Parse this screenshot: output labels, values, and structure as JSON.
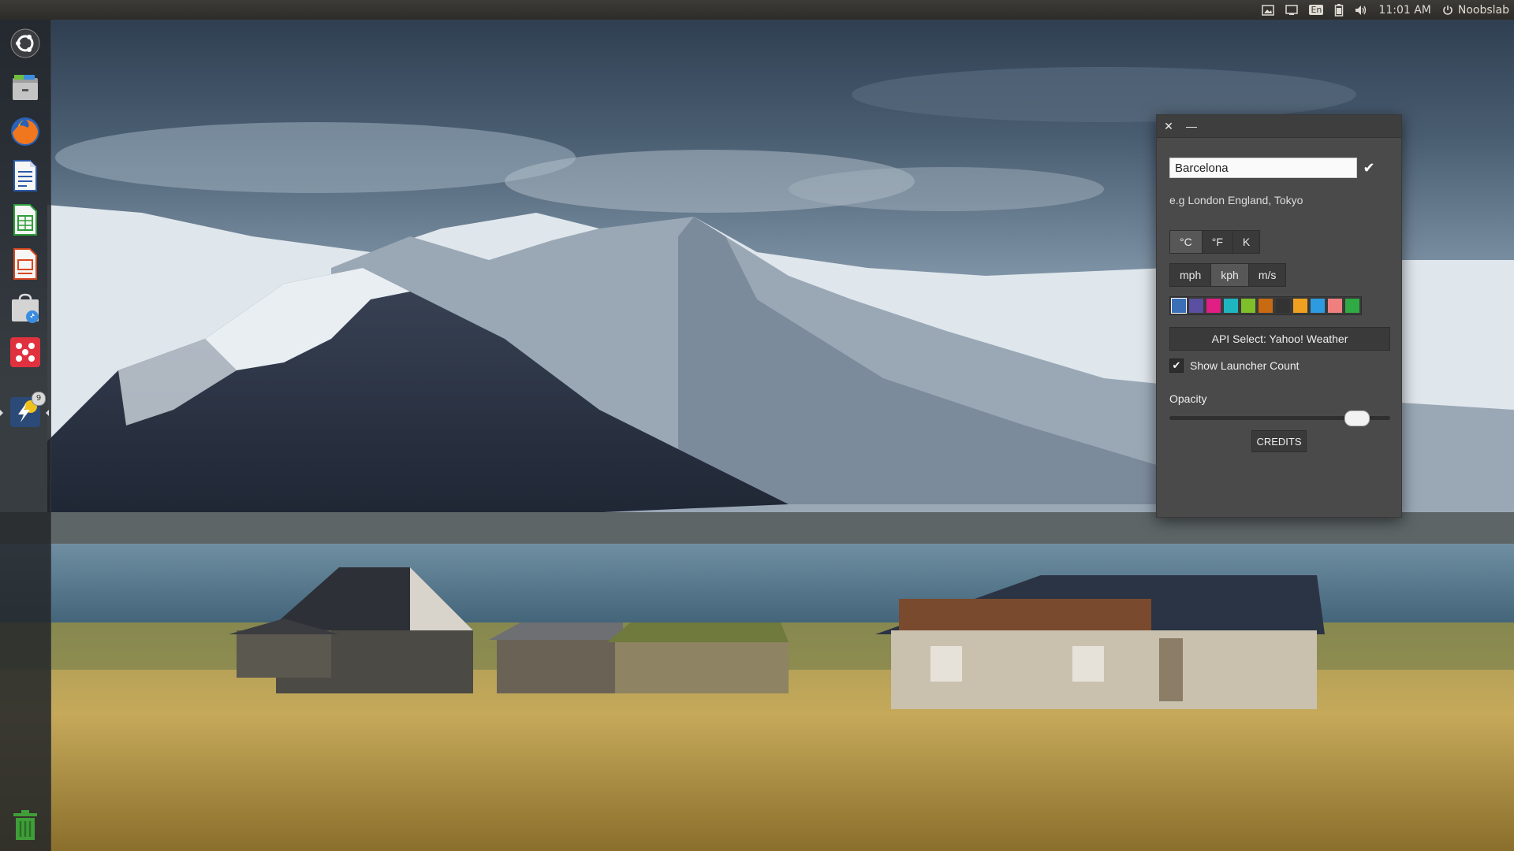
{
  "panel": {
    "clock": "11:01 AM",
    "user": "Noobslab",
    "keyboard_layout": "En",
    "indicators": [
      "image-icon",
      "display-icon",
      "keyboard-layout-icon",
      "battery-icon",
      "volume-icon",
      "power-icon"
    ]
  },
  "launcher": {
    "items": [
      {
        "name": "dash-home",
        "icon": "ubuntu-logo-icon"
      },
      {
        "name": "files",
        "icon": "folder-icon"
      },
      {
        "name": "firefox",
        "icon": "firefox-icon"
      },
      {
        "name": "writer",
        "icon": "document-icon"
      },
      {
        "name": "calc",
        "icon": "spreadsheet-icon"
      },
      {
        "name": "impress",
        "icon": "presentation-icon"
      },
      {
        "name": "software-center",
        "icon": "shopping-bag-icon"
      },
      {
        "name": "app-red",
        "icon": "dots-icon"
      },
      {
        "name": "weather-app",
        "icon": "lightning-icon",
        "count": "9"
      },
      {
        "name": "trash",
        "icon": "trash-icon"
      }
    ]
  },
  "settings": {
    "location_value": "Barcelona",
    "location_hint": "e.g London England, Tokyo",
    "temp_units": [
      "°C",
      "°F",
      "K"
    ],
    "temp_selected": 0,
    "speed_units": [
      "mph",
      "kph",
      "m/s"
    ],
    "speed_selected": 1,
    "swatches": [
      "#3b6fb6",
      "#5a4fa0",
      "#e01e84",
      "#1fb5c0",
      "#7fbf2a",
      "#c76a12",
      "#333333",
      "#f0a020",
      "#2d9be0",
      "#f08080",
      "#2faa44"
    ],
    "swatch_selected": 0,
    "api_label": "API Select: Yahoo! Weather",
    "show_launcher_count_label": "Show Launcher Count",
    "show_launcher_count_checked": true,
    "opacity_label": "Opacity",
    "opacity_value": 0.85,
    "credits_label": "CREDITS"
  },
  "colors": {
    "panel": "#3c3b37",
    "window": "#4a4a4a",
    "accent": "#e95420"
  }
}
